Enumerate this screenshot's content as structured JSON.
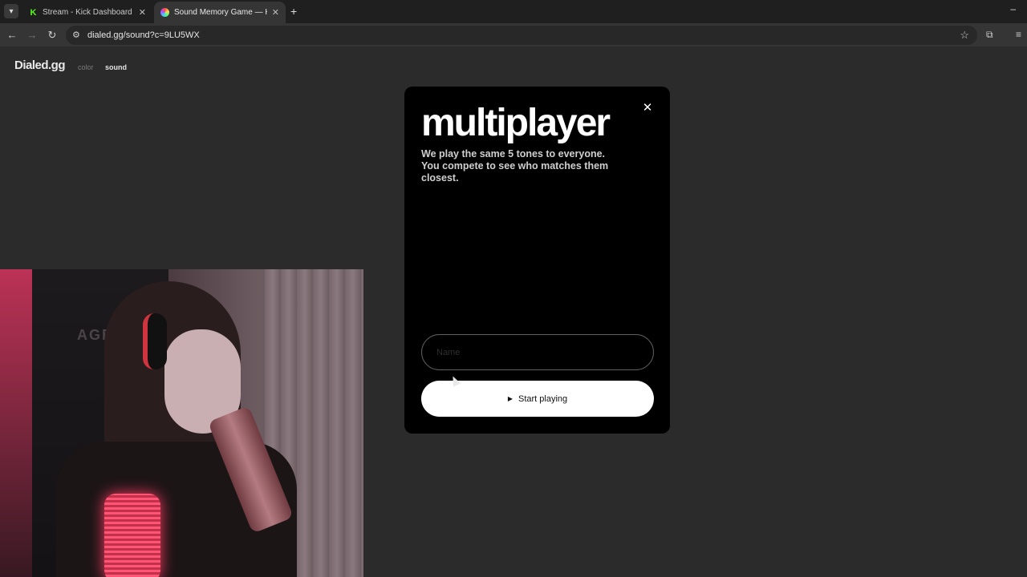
{
  "browser": {
    "tabs": [
      {
        "title": "Stream - Kick Dashboard",
        "icon": "kick-icon",
        "active": false
      },
      {
        "title": "Sound Memory Game — How G",
        "icon": "dialed-orb-icon",
        "active": true
      }
    ],
    "url": "dialed.gg/sound?c=9LU5WX",
    "new_tab_glyph": "+",
    "close_glyph": "✕"
  },
  "site": {
    "logo": "Dialed.gg",
    "nav": {
      "color": "color",
      "sound": "sound"
    }
  },
  "modal": {
    "title": "multiplayer",
    "description": "We play the same 5 tones to everyone. You compete to see who matches them closest.",
    "name_placeholder": "Name",
    "start_label": "Start playing",
    "close_glyph": "✕"
  },
  "webcam": {
    "chair_text": "AGEV"
  },
  "colors": {
    "page_bg": "#2b2b2b",
    "modal_bg": "#000000",
    "button_bg": "#ffffff",
    "kick_green": "#53fc18"
  }
}
